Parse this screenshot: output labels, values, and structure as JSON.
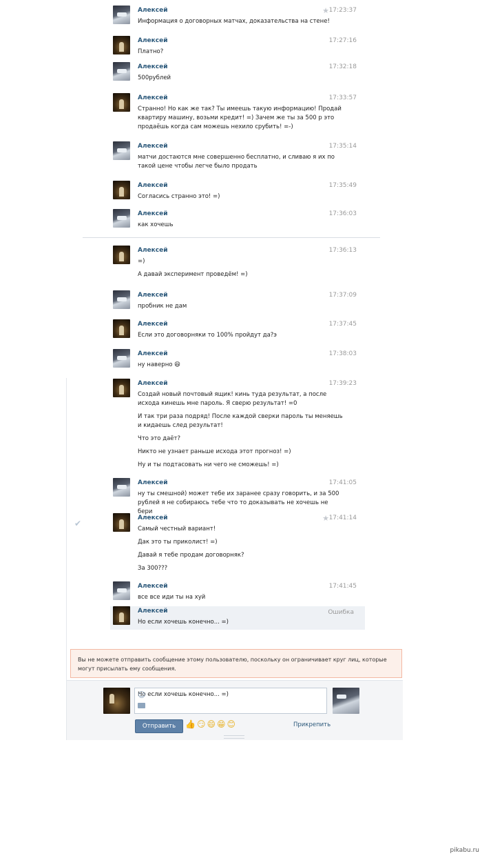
{
  "messages": [
    {
      "author": "Алексей",
      "avatar": "b",
      "time": "17:23:37",
      "star": true,
      "lines": [
        "Информация о договорных матчах, доказательства на стене!"
      ]
    },
    {
      "author": "Алексей",
      "avatar": "a",
      "time": "17:27:16",
      "lines": [
        "Платно?"
      ]
    },
    {
      "author": "Алексей",
      "avatar": "b",
      "time": "17:32:18",
      "lines": [
        "500рублей"
      ]
    },
    {
      "author": "Алексей",
      "avatar": "a",
      "time": "17:33:57",
      "lines": [
        "Странно! Но как же так? Ты имеешь такую информацию! Продай квартиру машину, возьми кредит! =) Зачем же ты за 500 р это продаёшь когда сам можешь нехило срубить! =-)"
      ]
    },
    {
      "author": "Алексей",
      "avatar": "b",
      "time": "17:35:14",
      "lines": [
        "матчи достаются мне совершенно бесплатно, и сливаю я их по такой цене чтобы легче было продать"
      ]
    },
    {
      "author": "Алексей",
      "avatar": "a",
      "time": "17:35:49",
      "lines": [
        "Согласись странно это! =)"
      ]
    },
    {
      "author": "Алексей",
      "avatar": "b",
      "time": "17:36:03",
      "lines": [
        "как хочешь"
      ]
    },
    {
      "author": "Алексей",
      "avatar": "a",
      "time": "17:36:13",
      "lines": [
        "=)",
        "А давай эксперимент проведём! =)"
      ]
    },
    {
      "author": "Алексей",
      "avatar": "b",
      "time": "17:37:09",
      "lines": [
        "пробник не дам"
      ]
    },
    {
      "author": "Алексей",
      "avatar": "a",
      "time": "17:37:45",
      "lines": [
        "Если это договорняки то 100% пройдут да?э"
      ]
    },
    {
      "author": "Алексей",
      "avatar": "b",
      "time": "17:38:03",
      "lines": [
        "ну наверно 😆"
      ]
    },
    {
      "author": "Алексей",
      "avatar": "a",
      "time": "17:39:23",
      "lines": [
        "Создай новый почтовый ящик! кинь туда результат, а после исхода кинешь мне пароль. Я сверю результат! =0",
        "И так три раза подряд! После каждой сверки пароль ты меняешь и кидаешь след результат!",
        "Что это даёт?",
        "Никто не узнает раньше исхода этот прогноз! =)",
        "Ну и ты подтасовать ни чего не сможешь! =)"
      ]
    },
    {
      "author": "Алексей",
      "avatar": "b",
      "time": "17:41:05",
      "lines": [
        "ну ты смешной) может тебе их заранее сразу говорить, и за 500 рублей я не собираюсь тебе что то доказывать не хочешь не бери"
      ]
    },
    {
      "author": "Алексей",
      "avatar": "a",
      "time": "17:41:14",
      "star": true,
      "lines": [
        "Самый честный вариант!",
        "Дак это ты приколист! =)",
        "Давай я тебе продам договорняк?",
        "За 300???"
      ]
    },
    {
      "author": "Алексей",
      "avatar": "b",
      "time": "17:41:45",
      "lines": [
        "все все иди ты на хуй"
      ]
    },
    {
      "author": "Алексей",
      "avatar": "a",
      "time": "Ошибка",
      "error": true,
      "lines": [
        "Но если хочешь конечно... =)"
      ]
    }
  ],
  "warning": "Вы не можете отправить сообщение этому пользователю, поскольку он ограничивает круг лиц, которые могут присылать ему сообщения.",
  "composer": {
    "draft": "Но если хочешь конечно... =)",
    "send_label": "Отправить",
    "attach_label": "Прикрепить",
    "emojis": "👍😏😄😁😊"
  },
  "footer": "pikabu.ru"
}
